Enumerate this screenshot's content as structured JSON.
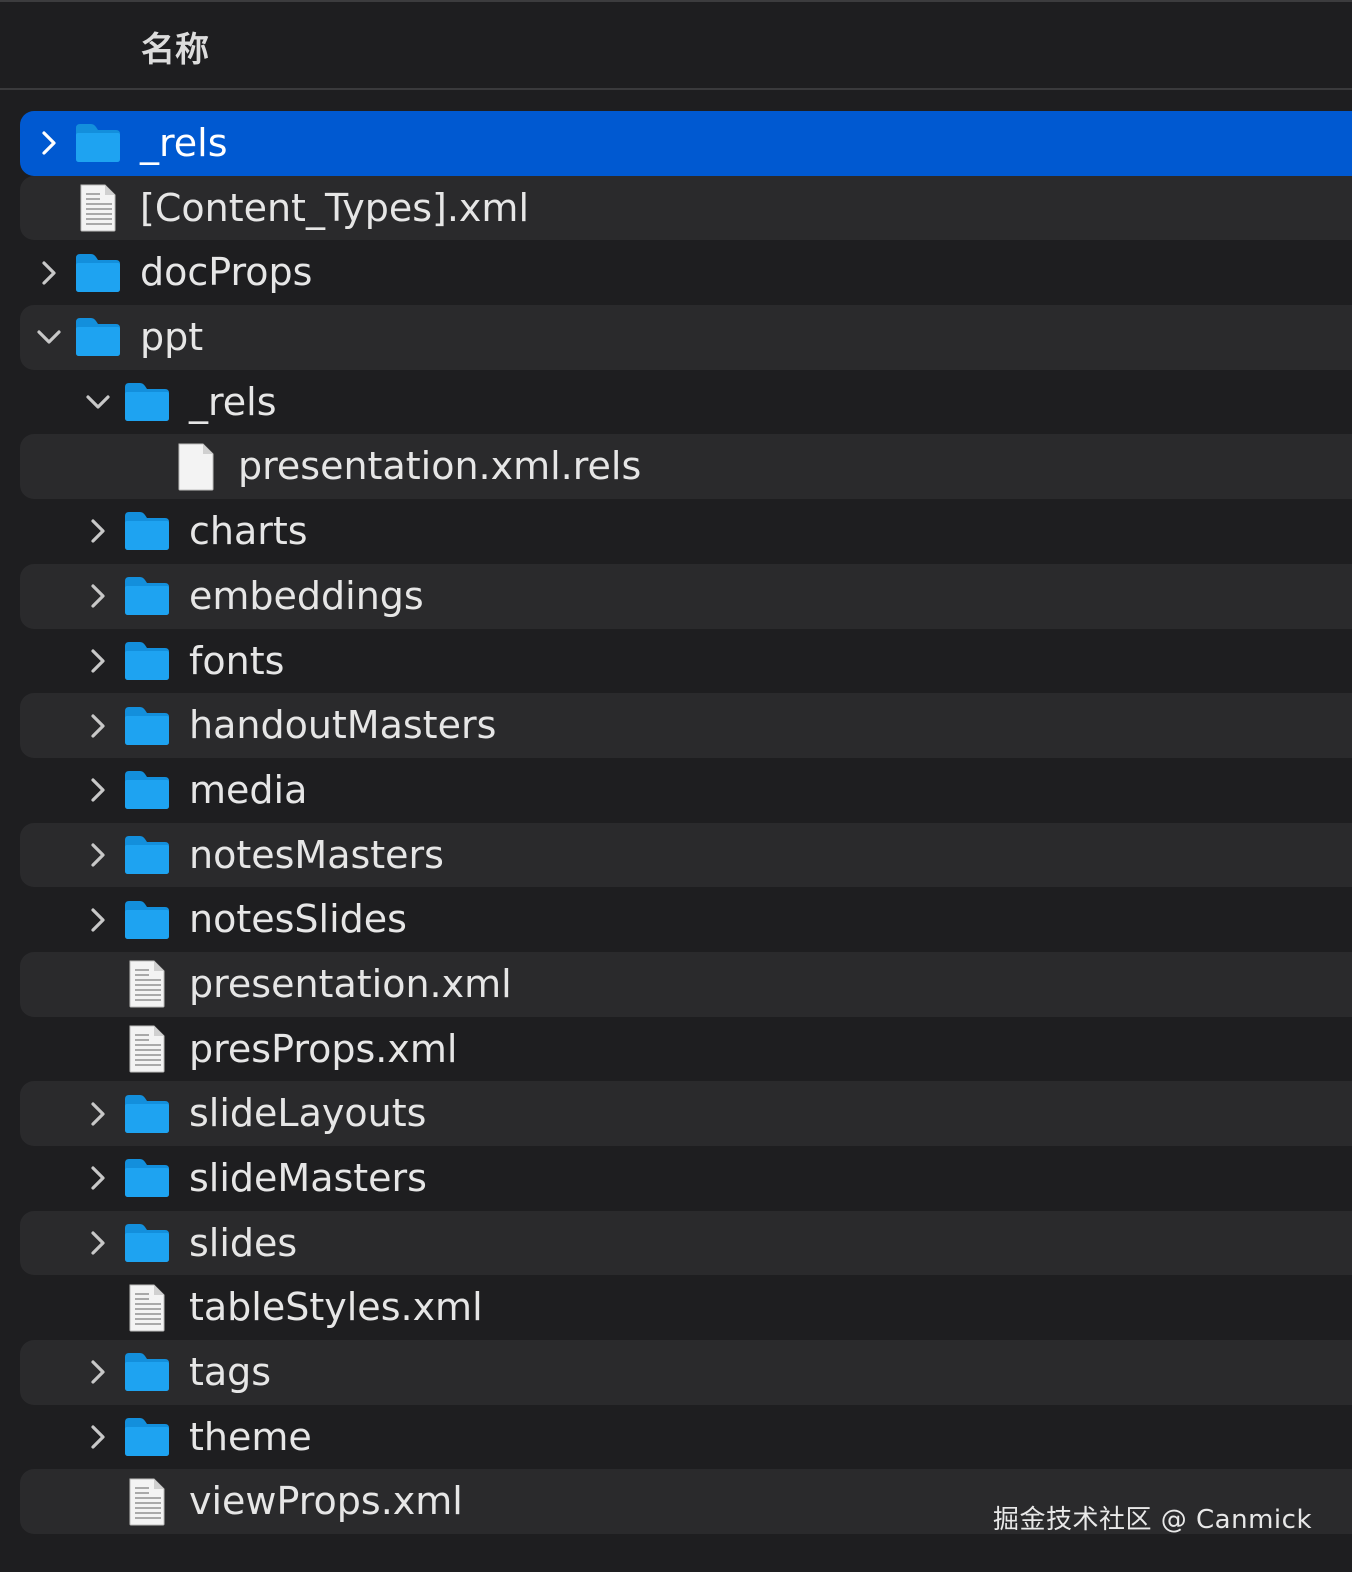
{
  "header": {
    "column_label": "名称"
  },
  "colors": {
    "background": "#1e1e20",
    "row_alt": "#2a2a2c",
    "selection": "#0059d1",
    "folder": "#1ea3f1"
  },
  "rows": [
    {
      "name": "_rels",
      "kind": "folder",
      "depth": 0,
      "state": "collapsed",
      "selected": true,
      "icon": "folder-icon"
    },
    {
      "name": "[Content_Types].xml",
      "kind": "xml",
      "depth": 0,
      "state": "none",
      "selected": false,
      "icon": "xml-file-icon"
    },
    {
      "name": "docProps",
      "kind": "folder",
      "depth": 0,
      "state": "collapsed",
      "selected": false,
      "icon": "folder-icon"
    },
    {
      "name": "ppt",
      "kind": "folder",
      "depth": 0,
      "state": "expanded",
      "selected": false,
      "icon": "folder-icon"
    },
    {
      "name": "_rels",
      "kind": "folder",
      "depth": 1,
      "state": "expanded",
      "selected": false,
      "icon": "folder-icon"
    },
    {
      "name": "presentation.xml.rels",
      "kind": "file",
      "depth": 2,
      "state": "none",
      "selected": false,
      "icon": "blank-file-icon"
    },
    {
      "name": "charts",
      "kind": "folder",
      "depth": 1,
      "state": "collapsed",
      "selected": false,
      "icon": "folder-icon"
    },
    {
      "name": "embeddings",
      "kind": "folder",
      "depth": 1,
      "state": "collapsed",
      "selected": false,
      "icon": "folder-icon"
    },
    {
      "name": "fonts",
      "kind": "folder",
      "depth": 1,
      "state": "collapsed",
      "selected": false,
      "icon": "folder-icon"
    },
    {
      "name": "handoutMasters",
      "kind": "folder",
      "depth": 1,
      "state": "collapsed",
      "selected": false,
      "icon": "folder-icon"
    },
    {
      "name": "media",
      "kind": "folder",
      "depth": 1,
      "state": "collapsed",
      "selected": false,
      "icon": "folder-icon"
    },
    {
      "name": "notesMasters",
      "kind": "folder",
      "depth": 1,
      "state": "collapsed",
      "selected": false,
      "icon": "folder-icon"
    },
    {
      "name": "notesSlides",
      "kind": "folder",
      "depth": 1,
      "state": "collapsed",
      "selected": false,
      "icon": "folder-icon"
    },
    {
      "name": "presentation.xml",
      "kind": "xml",
      "depth": 1,
      "state": "none",
      "selected": false,
      "icon": "xml-file-icon"
    },
    {
      "name": "presProps.xml",
      "kind": "xml",
      "depth": 1,
      "state": "none",
      "selected": false,
      "icon": "xml-file-icon"
    },
    {
      "name": "slideLayouts",
      "kind": "folder",
      "depth": 1,
      "state": "collapsed",
      "selected": false,
      "icon": "folder-icon"
    },
    {
      "name": "slideMasters",
      "kind": "folder",
      "depth": 1,
      "state": "collapsed",
      "selected": false,
      "icon": "folder-icon"
    },
    {
      "name": "slides",
      "kind": "folder",
      "depth": 1,
      "state": "collapsed",
      "selected": false,
      "icon": "folder-icon"
    },
    {
      "name": "tableStyles.xml",
      "kind": "xml",
      "depth": 1,
      "state": "none",
      "selected": false,
      "icon": "xml-file-icon"
    },
    {
      "name": "tags",
      "kind": "folder",
      "depth": 1,
      "state": "collapsed",
      "selected": false,
      "icon": "folder-icon"
    },
    {
      "name": "theme",
      "kind": "folder",
      "depth": 1,
      "state": "collapsed",
      "selected": false,
      "icon": "folder-icon"
    },
    {
      "name": "viewProps.xml",
      "kind": "xml",
      "depth": 1,
      "state": "none",
      "selected": false,
      "icon": "xml-file-icon"
    }
  ],
  "watermark": "掘金技术社区 @ Canmick"
}
